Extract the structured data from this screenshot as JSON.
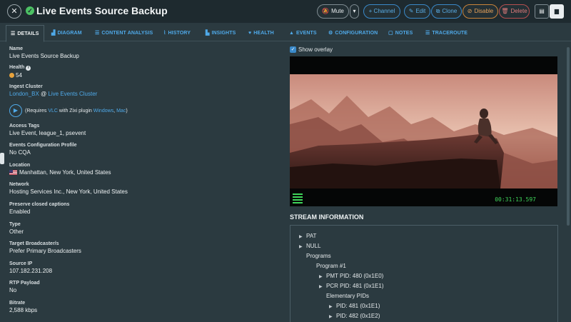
{
  "header": {
    "close_glyph": "✕",
    "title": "Live Events Source Backup",
    "buttons": {
      "mute": "Mute",
      "dropdown": "▾",
      "channel": "+ Channel",
      "edit": "Edit",
      "clone": "Clone",
      "disable": "Disable",
      "delete": "Delete"
    }
  },
  "tabs": [
    {
      "label": "DETAILS",
      "icon": "list-icon"
    },
    {
      "label": "DIAGRAM",
      "icon": "diagram-icon"
    },
    {
      "label": "CONTENT ANALYSIS",
      "icon": "list-icon"
    },
    {
      "label": "HISTORY",
      "icon": "chart-icon"
    },
    {
      "label": "INSIGHTS",
      "icon": "chart-icon"
    },
    {
      "label": "HEALTH",
      "icon": "heart-icon"
    },
    {
      "label": "EVENTS",
      "icon": "warning-icon"
    },
    {
      "label": "CONFIGURATION",
      "icon": "gear-icon"
    },
    {
      "label": "NOTES",
      "icon": "note-icon"
    },
    {
      "label": "TRACEROUTE",
      "icon": "list-icon"
    }
  ],
  "details": {
    "name": {
      "label": "Name",
      "value": "Live Events Source Backup"
    },
    "health": {
      "label": "Health",
      "value": "54",
      "color": "#e6a23c"
    },
    "ingest_cluster": {
      "label": "Ingest Cluster",
      "host": "London_BX",
      "at": "@",
      "cluster": "Live Events Cluster"
    },
    "vlc": {
      "prefix": "(Requires",
      "vlc": "VLC",
      "middle": "with Zixi plugin",
      "windows": "Windows",
      "comma": ",",
      "mac": "Mac",
      "suffix": ")"
    },
    "access_tags": {
      "label": "Access Tags",
      "value": "Live Event, league_1, psevent"
    },
    "events_profile": {
      "label": "Events Configuration Profile",
      "value": "No CQA"
    },
    "location": {
      "label": "Location",
      "value": "Manhattan, New York, United States"
    },
    "network": {
      "label": "Network",
      "value": "Hosting Services Inc., New York, United States"
    },
    "closed_captions": {
      "label": "Preserve closed captions",
      "value": "Enabled"
    },
    "type": {
      "label": "Type",
      "value": "Other"
    },
    "target_broadcaster": {
      "label": "Target Broadcaster/s",
      "value": "Prefer Primary Broadcasters"
    },
    "source_ip": {
      "label": "Source IP",
      "value": "107.182.231.208"
    },
    "rtp_payload": {
      "label": "RTP Payload",
      "value": "No"
    },
    "bitrate": {
      "label": "Bitrate",
      "value": "2,588 kbps"
    }
  },
  "preview": {
    "show_overlay_label": "Show overlay",
    "show_overlay_checked": true,
    "timecode": "00:31:13.597"
  },
  "stream_info": {
    "title": "STREAM INFORMATION",
    "nodes": [
      "PAT",
      "NULL",
      "Programs",
      "Program #1",
      "PMT PID: 480 (0x1E0)",
      "PCR PID: 481 (0x1E1)",
      "Elementary PIDs",
      "PID: 481 (0x1E1)",
      "PID: 482 (0x1E2)"
    ]
  },
  "colors": {
    "accent": "#4fa9e8",
    "ok": "#4cc164",
    "warning": "#e6a23c",
    "danger": "#e07b7b"
  }
}
